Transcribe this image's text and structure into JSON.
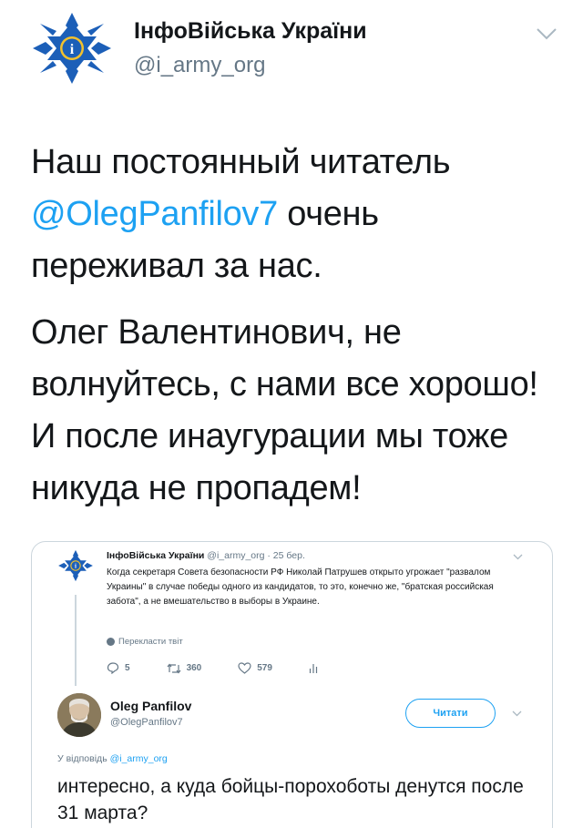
{
  "tweet": {
    "author_name": "ІнфоВійська України",
    "author_handle": "@i_army_org",
    "logo_icon": "blue-cross-emblem-icon",
    "menu_icon": "chevron-down-icon",
    "text_line1": "Наш постоянный читатель",
    "mention": "@OlegPanfilov7",
    "text_after_mention": " очень",
    "text_line3": "переживал за нас.",
    "paragraph2": "Олег Валентинович, не волнуйтесь, с нами все хорошо! И после инаугурации мы тоже никуда не пропадем!"
  },
  "quoted_thread": {
    "parent": {
      "name": "ІнфоВійська України",
      "handle_time": " @i_army_org · 25 бер.",
      "text": "Когда секретаря Совета безопасности РФ Николай Патрушев открыто угрожает \"развалом Украины\" в случае победы одного из кандидатов, то это, конечно же, \"братская российская забота\", а не вмешательство в выборы в Украине.",
      "translate_label": "Перекласти твіт",
      "replies": "5",
      "retweets": "360",
      "likes": "579"
    },
    "reply": {
      "name": "Oleg Panfilov",
      "handle": "@OlegPanfilov7",
      "follow_label": "Читати",
      "replying_to_prefix": "У відповідь ",
      "replying_to_handle": "@i_army_org",
      "text": "интересно, а куда бойцы-порохоботы денутся после 31 марта?"
    }
  },
  "colors": {
    "link": "#1da1f2",
    "secondary_text": "#657786",
    "border": "#ccd6dd",
    "logo_blue": "#1c5fb8",
    "logo_gold": "#f2c12e"
  }
}
